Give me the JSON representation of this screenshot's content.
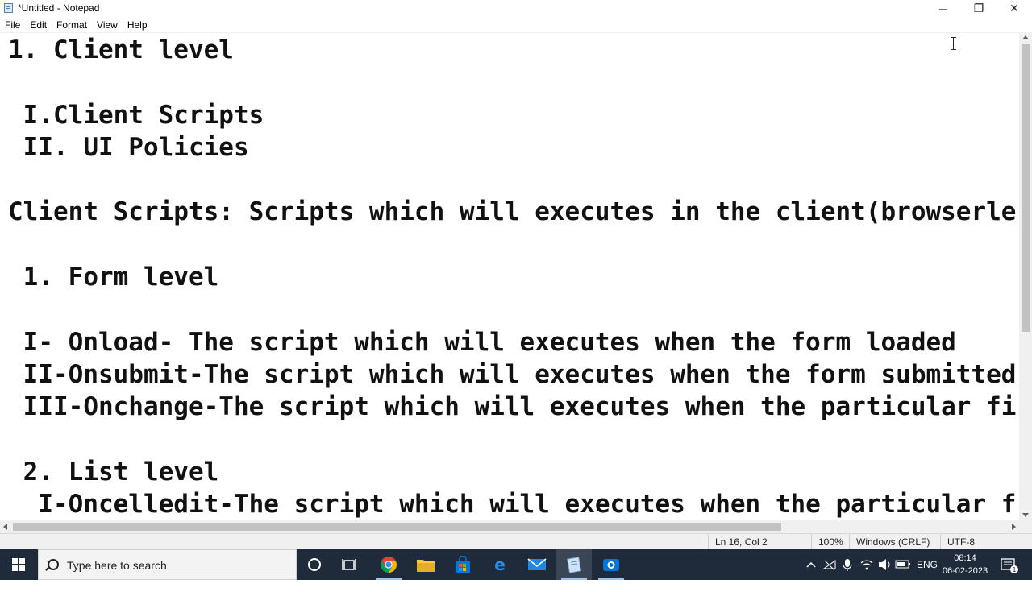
{
  "window": {
    "title": "*Untitled - Notepad",
    "controls": {
      "minimize": "─",
      "restore": "❐",
      "close": "✕"
    }
  },
  "menu": [
    "File",
    "Edit",
    "Format",
    "View",
    "Help"
  ],
  "editor": {
    "lines": [
      "1. Client level",
      "",
      " I.Client Scripts",
      " II. UI Policies",
      "",
      "Client Scripts: Scripts which will executes in the client(browserle",
      "",
      " 1. Form level",
      "",
      " I- Onload- The script which will executes when the form loaded",
      " II-Onsubmit-The script which will executes when the form submitted",
      " III-Onchange-The script which will executes when the particular fi",
      "",
      " 2. List level",
      "  I-Oncelledit-The script which will executes when the particular f"
    ]
  },
  "status": {
    "position": "Ln 16, Col 2",
    "zoom": "100%",
    "line_endings": "Windows (CRLF)",
    "encoding": "UTF-8"
  },
  "taskbar": {
    "search_placeholder": "Type here to search",
    "language": "ENG",
    "time": "08:14",
    "date": "06-02-2023",
    "notification_count": "1",
    "pinned_icons": [
      "cortana-icon",
      "task-view-icon",
      "chrome-icon",
      "file-explorer-icon",
      "store-icon",
      "edge-icon",
      "mail-icon",
      "notepad-icon",
      "camera-icon"
    ]
  },
  "colors": {
    "taskbar_bg": "#1f2b3a",
    "text": "#111111",
    "accent": "#0078d7"
  }
}
